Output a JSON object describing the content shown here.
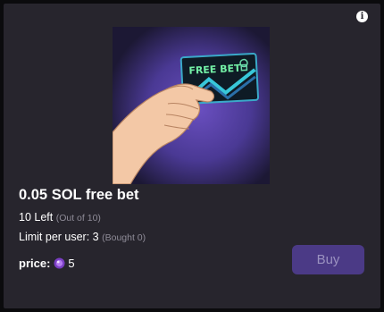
{
  "item": {
    "title": "0.05 SOL free bet",
    "left_label": "10 Left",
    "left_total": "(Out of 10)",
    "limit_label": "Limit per user: 3",
    "limit_bought": "(Bought 0)",
    "price_label": "price:",
    "price_amount": "5",
    "card_text": "FREE BET"
  },
  "buy_label": "Buy",
  "info_icon": "i",
  "colors": {
    "card_bg": "#27252d",
    "button_bg": "#4b3a86",
    "button_text": "#9a91c0",
    "muted_text": "#8e8b97"
  }
}
